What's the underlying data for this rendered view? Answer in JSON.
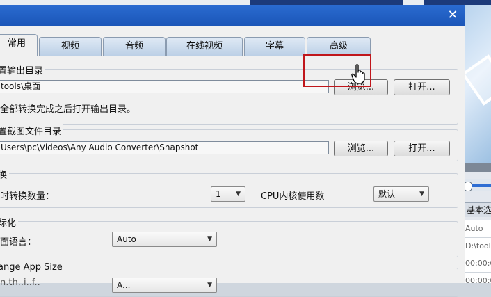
{
  "window": {
    "close_glyph": "✕"
  },
  "tabs": [
    {
      "label": "常用",
      "active": true
    },
    {
      "label": "视频"
    },
    {
      "label": "音频"
    },
    {
      "label": "在线视频"
    },
    {
      "label": "字幕"
    },
    {
      "label": "高级",
      "highlighted": true
    }
  ],
  "output_dir": {
    "title": "置输出目录",
    "path": "tools\\桌面",
    "browse_label": "浏览...",
    "open_label": "打开...",
    "option_text": "全部转换完成之后打开输出目录。"
  },
  "snapshot_dir": {
    "title": "置截图文件目录",
    "path": "Users\\pc\\Videos\\Any Audio Converter\\Snapshot",
    "browse_label": "浏览...",
    "open_label": "打开..."
  },
  "conversion": {
    "title": "换",
    "count_label": "时转换数量：",
    "count_value": "1",
    "cpu_label": "CPU内核使用数",
    "cpu_value": "默认"
  },
  "localization": {
    "title": "际化",
    "language_label": "面语言：",
    "language_value": "Auto"
  },
  "app_size": {
    "title": "ange App Size",
    "row_label": "n.th..i..f..",
    "row_value": "A..."
  },
  "right_panel": {
    "tab_label": "基本选项",
    "rows": [
      "Auto",
      "D:\\tool",
      "00:00:0",
      "00:00:0"
    ]
  },
  "colors": {
    "titlebar": "#1b56b8",
    "highlight": "#c0161b",
    "slider_accent": "#2f6ed3"
  }
}
